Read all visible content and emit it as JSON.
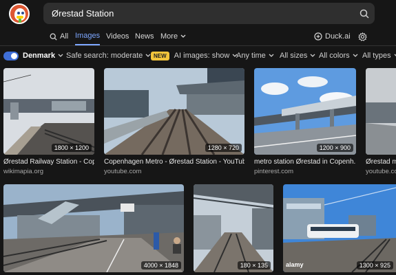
{
  "search": {
    "query": "Ørestad Station"
  },
  "nav": {
    "all": "All",
    "images": "Images",
    "videos": "Videos",
    "news": "News",
    "more": "More",
    "duck_ai": "Duck.ai"
  },
  "filters": {
    "region": "Denmark",
    "safe_search": "Safe search: moderate",
    "new_badge": "NEW",
    "ai_images": "AI images: show",
    "time": "Any time",
    "sizes": "All sizes",
    "colors": "All colors",
    "types": "All types"
  },
  "colors": {
    "accent": "#7da7ff",
    "badge": "#f2c43b",
    "logo": "#de5833",
    "background": "#161616"
  },
  "results": [
    {
      "title": "Ørestad Railway Station - Cop...",
      "source": "wikimapia.org",
      "dims": "1800 × 1200"
    },
    {
      "title": "Copenhagen Metro - Ørestad Station - YouTube",
      "source": "youtube.com",
      "dims": "1280 × 720"
    },
    {
      "title": "metro station Ørestad in Copenh...",
      "source": "pinterest.com",
      "dims": "1200 × 900"
    },
    {
      "title": "Ørestad m...",
      "source": "youtube.com",
      "dims": ""
    },
    {
      "title": "",
      "source": "",
      "dims": "4000 × 1848"
    },
    {
      "title": "",
      "source": "",
      "dims": "180 × 135"
    },
    {
      "title": "",
      "source": "",
      "dims": "1300 × 925"
    }
  ],
  "watermark": "alamy"
}
